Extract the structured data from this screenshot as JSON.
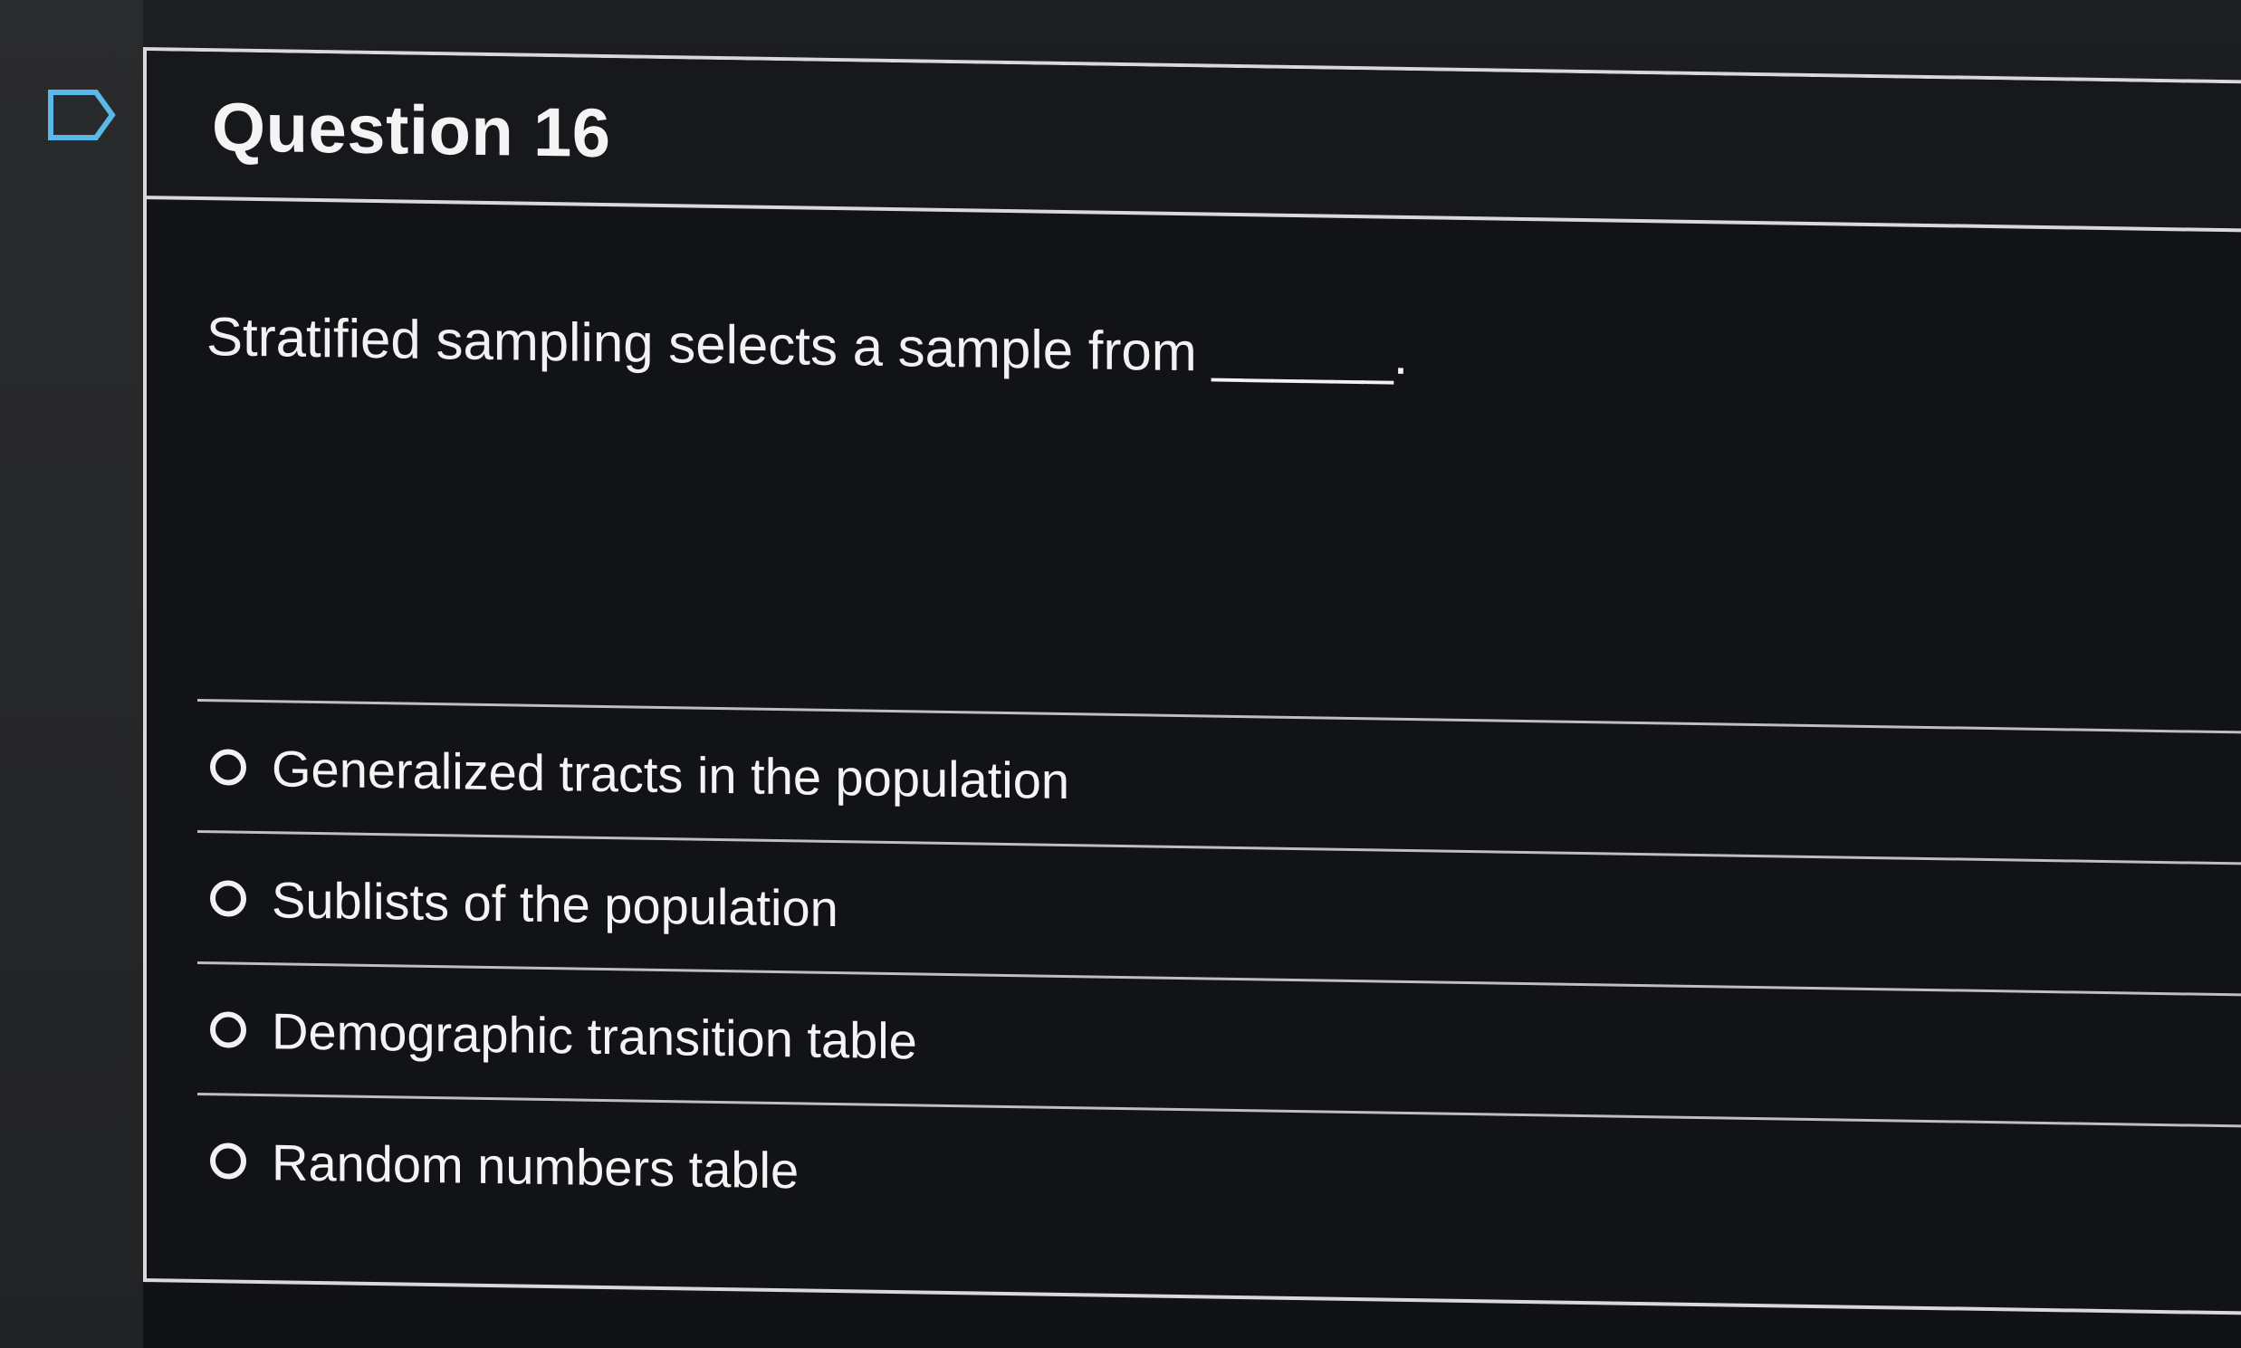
{
  "question": {
    "title": "Question 16",
    "prompt": "Stratified sampling selects a sample from ______.",
    "flag_icon": "flag-outline-icon",
    "accent_color": "#5bb8e8"
  },
  "options": [
    {
      "label": "Generalized tracts in the population",
      "selected": false
    },
    {
      "label": "Sublists of the population",
      "selected": false
    },
    {
      "label": "Demographic transition table",
      "selected": false
    },
    {
      "label": "Random numbers table",
      "selected": false
    }
  ]
}
